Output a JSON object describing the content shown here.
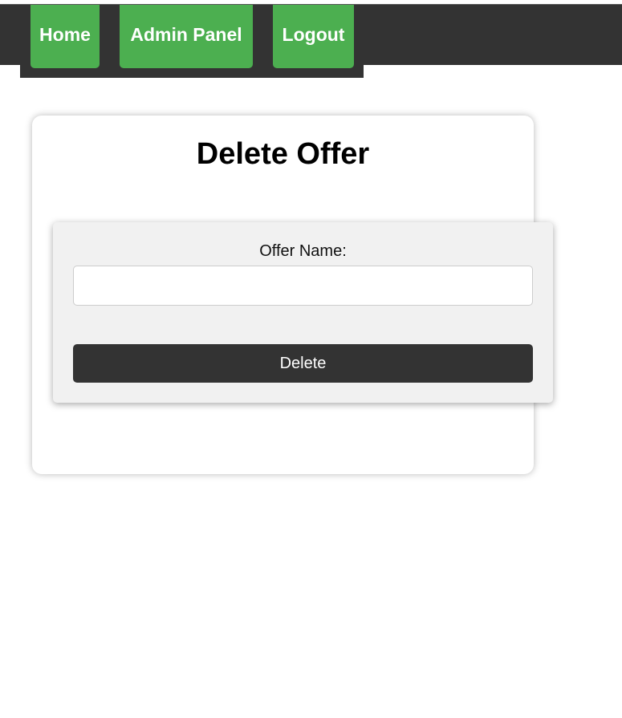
{
  "nav": {
    "home_label": "Home",
    "admin_label": "Admin Panel",
    "logout_label": "Logout"
  },
  "page": {
    "title": "Delete Offer"
  },
  "form": {
    "offer_name_label": "Offer Name:",
    "offer_name_value": "",
    "offer_name_placeholder": "",
    "delete_label": "Delete"
  },
  "colors": {
    "nav_background": "#333333",
    "nav_button": "#4caf50",
    "form_background": "#f1f1f1",
    "delete_button": "#333333"
  }
}
